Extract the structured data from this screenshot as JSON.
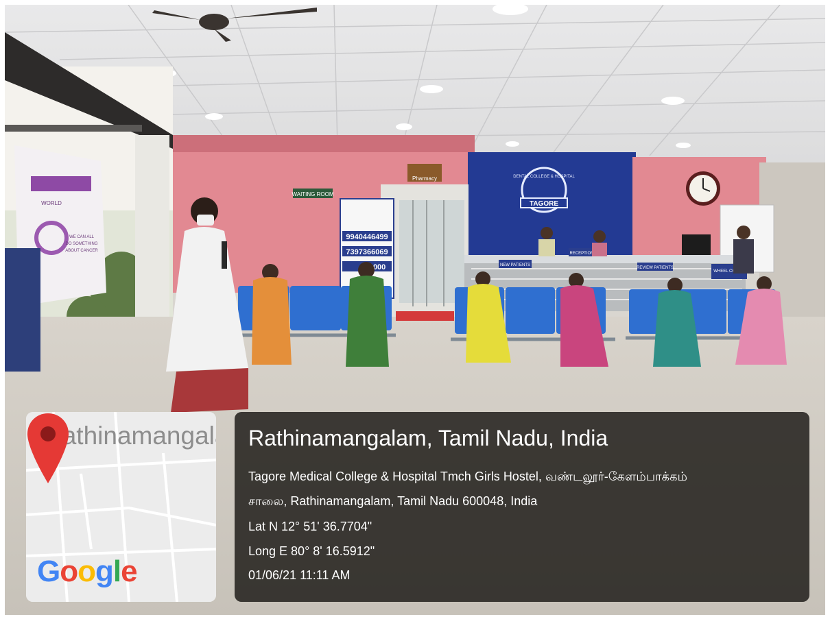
{
  "photo": {
    "signs": {
      "waiting_room": "WAITING ROOM",
      "pharmacy": "Pharmacy",
      "hospital_logo": "TAGORE",
      "hospital_logo_ring": "DENTAL COLLEGE & HOSPITAL",
      "reception_desk": "RECEPTION DESK",
      "new_patients": "NEW PATIENTS",
      "review_patients": "REVIEW PATIENTS",
      "wheel_chairs": "WHEEL CHAIRS",
      "phone_1": "9940446499",
      "phone_2": "7397366069",
      "phone_3": "36000",
      "poster_line_1": "WE CAN ALL",
      "poster_line_2": "DO SOMETHING",
      "poster_line_3": "ABOUT CANCER",
      "poster_badge": "WORLD"
    }
  },
  "map": {
    "town_label": "Rathinamangalam",
    "logo": "Google"
  },
  "info": {
    "title": "Rathinamangalam, Tamil Nadu, India",
    "address_line_1": "Tagore Medical College & Hospital Tmch Girls Hostel, வண்டலூர்-கேளம்பாக்கம்",
    "address_line_2": "சாலை, Rathinamangalam, Tamil Nadu 600048, India",
    "latitude": "Lat N 12° 51' 36.7704\"",
    "longitude": "Long E 80° 8' 16.5912\"",
    "timestamp": "01/06/21 11:11 AM"
  },
  "colors": {
    "wall_pink": "#e28992",
    "wall_blue": "#233a93",
    "seat_blue": "#2f6fd0",
    "pin_red": "#e53935",
    "card_bg": "#1e1b18"
  }
}
